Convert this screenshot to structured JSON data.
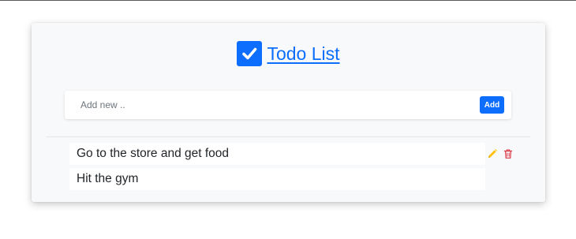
{
  "header": {
    "title": "Todo List",
    "icon": "check-square-icon",
    "accent_color": "#0d6efd"
  },
  "add_form": {
    "placeholder": "Add new ..",
    "value": "",
    "button_label": "Add"
  },
  "todos": [
    {
      "text": "Go to the store and get food",
      "actions": [
        "pencil-icon",
        "trash-icon"
      ]
    },
    {
      "text": "Hit the gym"
    }
  ],
  "colors": {
    "edit_icon": "#ffc107",
    "delete_icon": "#dc3545",
    "card_background": "#f8f9fa"
  }
}
